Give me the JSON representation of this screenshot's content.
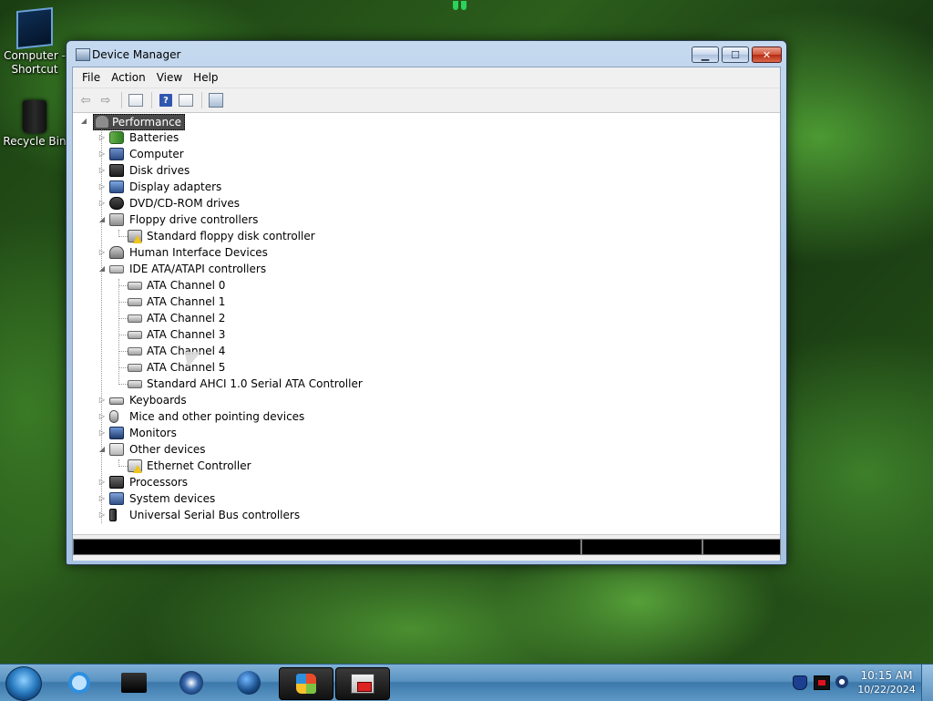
{
  "desktop": {
    "icons": [
      {
        "label": "Computer - Shortcut",
        "icon": "computer-shortcut-icon"
      },
      {
        "label": "Recycle Bin",
        "icon": "recycle-bin-icon"
      }
    ]
  },
  "window": {
    "title": "Device Manager",
    "controls": {
      "minimize": "▁",
      "maximize": "☐",
      "close": "✕"
    }
  },
  "menu": {
    "items": [
      "File",
      "Action",
      "View",
      "Help"
    ]
  },
  "toolbar": {
    "back": "⇦",
    "forward": "⇨",
    "help": "?"
  },
  "tree": {
    "root": "Performance",
    "categories": [
      {
        "label": "Batteries",
        "icon": "battery-icon",
        "expanded": false
      },
      {
        "label": "Computer",
        "icon": "computer-icon",
        "expanded": false
      },
      {
        "label": "Disk drives",
        "icon": "disk-drive-icon",
        "expanded": false
      },
      {
        "label": "Display adapters",
        "icon": "display-adapter-icon",
        "expanded": false
      },
      {
        "label": "DVD/CD-ROM drives",
        "icon": "dvd-drive-icon",
        "expanded": false
      },
      {
        "label": "Floppy drive controllers",
        "icon": "floppy-controller-icon",
        "expanded": true,
        "children": [
          {
            "label": "Standard floppy disk controller",
            "icon": "floppy-controller-warning-icon"
          }
        ]
      },
      {
        "label": "Human Interface Devices",
        "icon": "hid-icon",
        "expanded": false
      },
      {
        "label": "IDE ATA/ATAPI controllers",
        "icon": "ide-controller-icon",
        "expanded": true,
        "children": [
          {
            "label": "ATA Channel 0",
            "icon": "ata-channel-icon"
          },
          {
            "label": "ATA Channel 1",
            "icon": "ata-channel-icon"
          },
          {
            "label": "ATA Channel 2",
            "icon": "ata-channel-icon"
          },
          {
            "label": "ATA Channel 3",
            "icon": "ata-channel-icon"
          },
          {
            "label": "ATA Channel 4",
            "icon": "ata-channel-icon"
          },
          {
            "label": "ATA Channel 5",
            "icon": "ata-channel-icon"
          },
          {
            "label": "Standard AHCI 1.0 Serial ATA Controller",
            "icon": "ata-channel-icon"
          }
        ]
      },
      {
        "label": "Keyboards",
        "icon": "keyboard-icon",
        "expanded": false
      },
      {
        "label": "Mice and other pointing devices",
        "icon": "mouse-icon",
        "expanded": false
      },
      {
        "label": "Monitors",
        "icon": "monitor-icon",
        "expanded": false
      },
      {
        "label": "Other devices",
        "icon": "other-devices-icon",
        "expanded": true,
        "children": [
          {
            "label": "Ethernet Controller",
            "icon": "warning-device-icon"
          }
        ]
      },
      {
        "label": "Processors",
        "icon": "processor-icon",
        "expanded": false
      },
      {
        "label": "System devices",
        "icon": "system-devices-icon",
        "expanded": false
      },
      {
        "label": "Universal Serial Bus controllers",
        "icon": "usb-icon",
        "expanded": false
      }
    ]
  },
  "taskbar": {
    "apps": [
      "internet-explorer-icon",
      "black-app-icon",
      "media-player-icon",
      "globe-icon",
      "windows-explorer-icon",
      "device-manager-icon"
    ],
    "tray": [
      "security-shield-icon",
      "display-tray-icon",
      "network-tray-icon"
    ],
    "clock": {
      "time": "10:15 AM",
      "date": "10/22/2024"
    }
  }
}
